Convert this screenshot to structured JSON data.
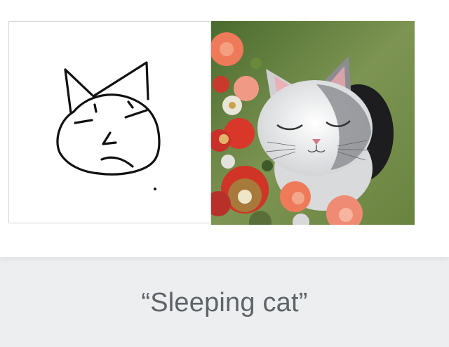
{
  "caption": "“Sleeping cat”",
  "panels": {
    "sketch": {
      "icon": "cat-sketch-drawing"
    },
    "generated": {
      "icon": "sleeping-cat-flowers-painting"
    }
  },
  "colors": {
    "background": "#eceef0",
    "card": "#ffffff",
    "caption_text": "#5f6368",
    "sketch_stroke": "#111111",
    "foliage_green": "#5f7a3a",
    "flower_red": "#d8372a",
    "flower_coral": "#ee7a5a"
  }
}
